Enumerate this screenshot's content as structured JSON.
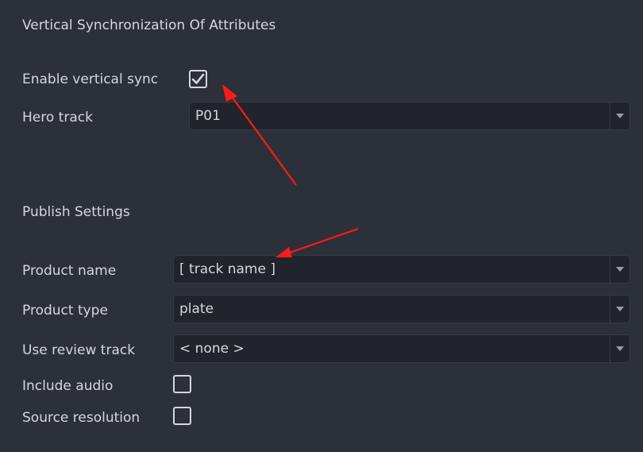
{
  "vertical_sync": {
    "title": "Vertical Synchronization Of Attributes",
    "enable_label": "Enable vertical sync",
    "enable_checked": true,
    "hero_track_label": "Hero track",
    "hero_track_value": "P01"
  },
  "publish": {
    "title": "Publish Settings",
    "product_name_label": "Product name",
    "product_name_value": "[ track name ]",
    "product_type_label": "Product type",
    "product_type_value": "plate",
    "review_track_label": "Use review track",
    "review_track_value": "< none >",
    "include_audio_label": "Include audio",
    "include_audio_checked": false,
    "source_resolution_label": "Source resolution",
    "source_resolution_checked": false
  },
  "annotations": {
    "arrow_color": "#ff1a1a"
  }
}
